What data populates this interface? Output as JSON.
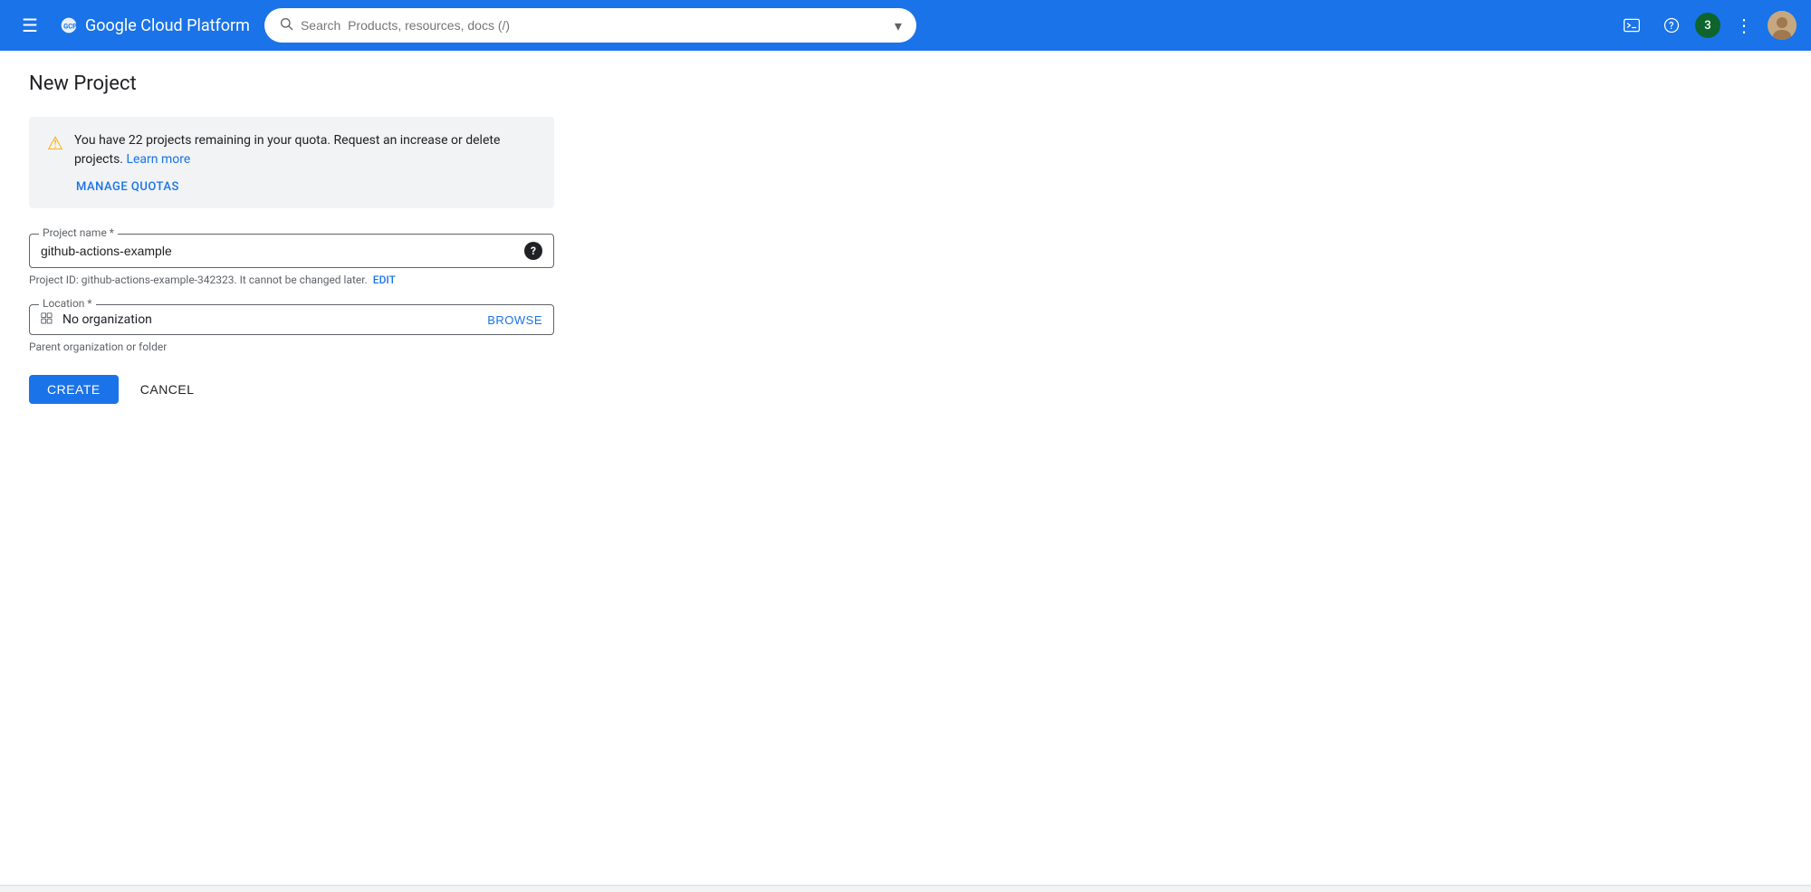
{
  "topnav": {
    "menu_icon": "☰",
    "app_name": "Google Cloud Platform",
    "search_placeholder": "Search  Products, resources, docs (/)",
    "dropdown_icon": "▾",
    "terminal_icon": ">_",
    "help_icon": "?",
    "notification_count": "3",
    "more_icon": "⋮"
  },
  "page": {
    "title": "New Project"
  },
  "alert": {
    "icon": "⚠",
    "message": "You have 22 projects remaining in your quota. Request an increase or delete projects.",
    "learn_more_label": "Learn more",
    "manage_label": "MANAGE QUOTAS"
  },
  "form": {
    "project_name_label": "Project name *",
    "project_name_value": "github-actions-example",
    "project_id_hint": "Project ID: github-actions-example-342323. It cannot be changed later.",
    "edit_label": "EDIT",
    "location_label": "Location *",
    "location_icon": "⊞",
    "location_value": "No organization",
    "browse_label": "BROWSE",
    "location_hint": "Parent organization or folder",
    "create_label": "CREATE",
    "cancel_label": "CANCEL"
  }
}
